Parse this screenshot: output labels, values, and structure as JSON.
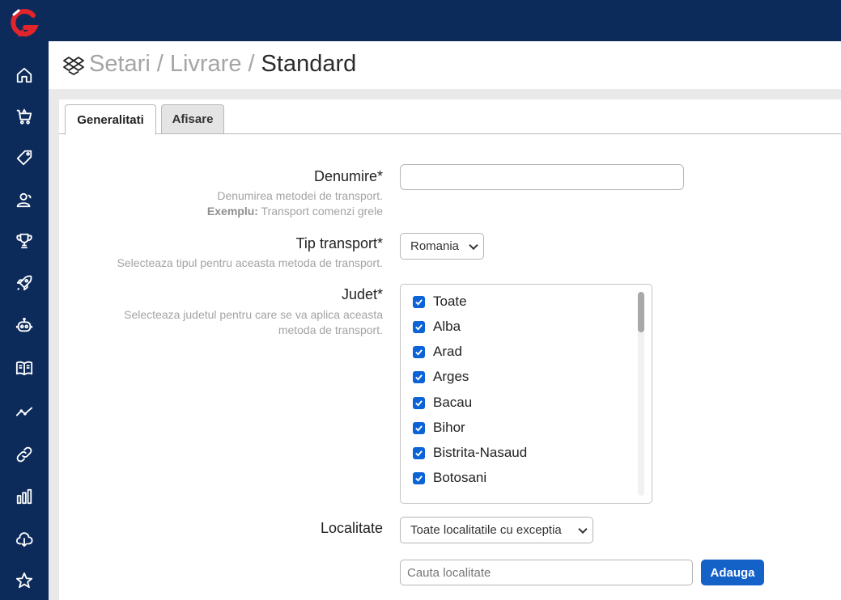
{
  "colors": {
    "sidebar_bg": "#0c2b5b",
    "accent": "#1461c7",
    "logo_red": "#e2242b",
    "icon_color": "#ffffff"
  },
  "sidebar": {
    "logo": "G",
    "items": [
      {
        "icon": "home-icon"
      },
      {
        "icon": "shopping-cart-icon"
      },
      {
        "icon": "tag-icon"
      },
      {
        "icon": "users-icon"
      },
      {
        "icon": "trophy-icon"
      },
      {
        "icon": "rocket-icon"
      },
      {
        "icon": "robot-icon"
      },
      {
        "icon": "book-icon"
      },
      {
        "icon": "trend-line-icon"
      },
      {
        "icon": "link-icon"
      },
      {
        "icon": "bar-chart-icon"
      },
      {
        "icon": "cloud-download-icon"
      },
      {
        "icon": "star-icon"
      }
    ]
  },
  "header": {
    "icon": "dropbox-icon",
    "crumb1": "Setari",
    "sep1": "/",
    "crumb2": "Livrare",
    "sep2": "/",
    "current": "Standard"
  },
  "tabs": [
    {
      "label": "Generalitati",
      "active": true
    },
    {
      "label": "Afisare",
      "active": false
    }
  ],
  "form": {
    "denumire": {
      "label": "Denumire*",
      "hint1": "Denumirea metodei de transport.",
      "hint2_bold": "Exemplu:",
      "hint2_rest": " Transport comenzi grele",
      "value": ""
    },
    "tip_transport": {
      "label": "Tip transport*",
      "hint": "Selecteaza tipul pentru aceasta metoda de transport.",
      "selected": "Romania"
    },
    "judet": {
      "label": "Judet*",
      "hint_line1": "Selecteaza judetul pentru care se va aplica aceasta",
      "hint_line2": "metoda de transport.",
      "options": [
        {
          "label": "Toate",
          "checked": true
        },
        {
          "label": "Alba",
          "checked": true
        },
        {
          "label": "Arad",
          "checked": true
        },
        {
          "label": "Arges",
          "checked": true
        },
        {
          "label": "Bacau",
          "checked": true
        },
        {
          "label": "Bihor",
          "checked": true
        },
        {
          "label": "Bistrita-Nasaud",
          "checked": true
        },
        {
          "label": "Botosani",
          "checked": true
        }
      ]
    },
    "localitate": {
      "label": "Localitate",
      "selected": "Toate localitatile cu exceptia",
      "search_placeholder": "Cauta localitate",
      "add_button": "Adauga"
    }
  }
}
